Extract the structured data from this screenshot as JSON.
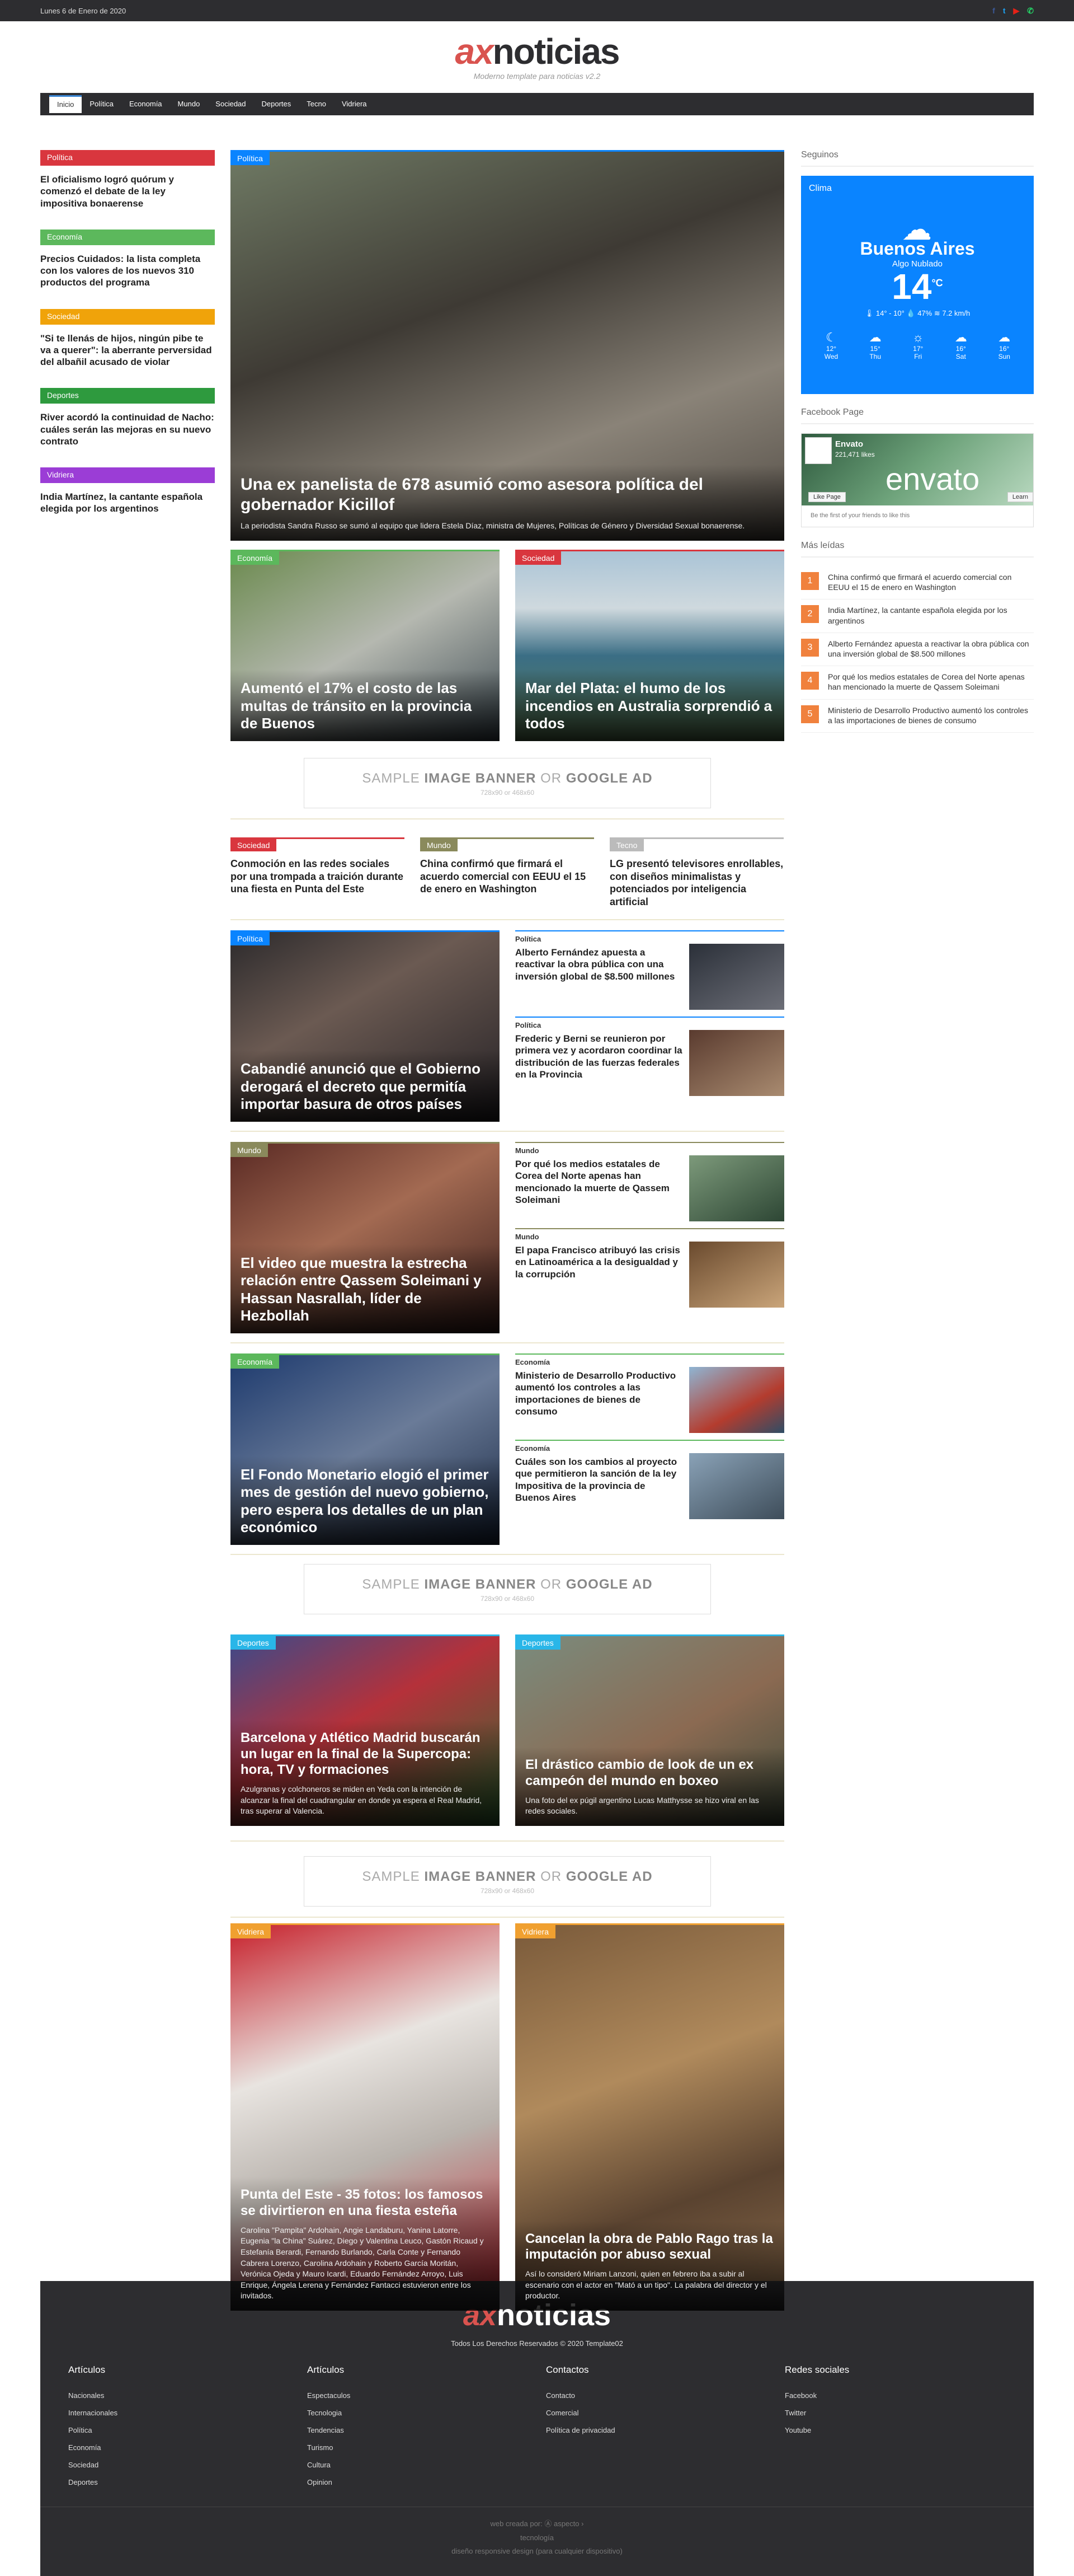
{
  "topbar": {
    "date": "Lunes 6 de Enero de 2020"
  },
  "brand": {
    "ax": "ax",
    "noticias": "noticias",
    "tagline": "Moderno template para noticias v2.2"
  },
  "nav": [
    "Inicio",
    "Política",
    "Economía",
    "Mundo",
    "Sociedad",
    "Deportes",
    "Tecno",
    "Vidriera"
  ],
  "left": [
    {
      "cat": "Política",
      "color": "#d9363e",
      "title": "El oficialismo logró quórum y comenzó el debate de la ley impositiva bonaerense"
    },
    {
      "cat": "Economía",
      "color": "#5cb85c",
      "title": "Precios Cuidados: la lista completa con los valores de los nuevos 310 productos del programa"
    },
    {
      "cat": "Sociedad",
      "color": "#f0a30a",
      "title": "\"Si te llenás de hijos, ningún pibe te va a querer\": la aberrante perversidad del albañil acusado de violar"
    },
    {
      "cat": "Deportes",
      "color": "#2e9a3e",
      "title": "River acordó la continuidad de Nacho: cuáles serán las mejoras en su nuevo contrato"
    },
    {
      "cat": "Vidriera",
      "color": "#9b3dd6",
      "title": "India Martínez, la cantante española elegida por los argentinos"
    }
  ],
  "hero": {
    "cat": "Política",
    "title": "Una ex panelista de 678 asumió como asesora política del gobernador Kicillof",
    "desc": "La periodista Sandra Russo se sumó al equipo que lidera Estela Díaz, ministra de Mujeres, Políticas de Género y Diversidad Sexual bonaerense."
  },
  "pair1": [
    {
      "cat": "Economía",
      "title": "Aumentó el 17% el costo de las multas de tránsito en la provincia de Buenos"
    },
    {
      "cat": "Sociedad",
      "title": "Mar del Plata: el humo de los incendios en Australia sorprendió a todos"
    }
  ],
  "ad": {
    "sample": "SAMPLE",
    "image": "IMAGE BANNER",
    "or": "OR",
    "google": "GOOGLE AD",
    "size": "728x90 or 468x60"
  },
  "row3": [
    {
      "cat": "Sociedad",
      "color": "#d9363e",
      "title": "Conmoción en las redes sociales por una trompada a traición durante una fiesta en Punta del Este"
    },
    {
      "cat": "Mundo",
      "color": "#8a8a5c",
      "title": "China confirmó que firmará el acuerdo comercial con EEUU el 15 de enero en Washington"
    },
    {
      "cat": "Tecno",
      "color": "#bbb",
      "title": "LG presentó televisores enrollables, con diseños minimalistas y potenciados por inteligencia artificial"
    }
  ],
  "blocks": [
    {
      "cat": "Política",
      "catcolor": "#0a84ff",
      "main": "Cabandié anunció que el Gobierno derogará el decreto que permitía importar basura de otros países",
      "items": [
        {
          "k": "Política",
          "h": "Alberto Fernández apuesta a reactivar la obra pública con una inversión global de $8.500 millones"
        },
        {
          "k": "Política",
          "h": "Frederic y Berni se reunieron por primera vez y acordaron coordinar la distribución de las fuerzas federales en la Provincia"
        }
      ]
    },
    {
      "cat": "Mundo",
      "catcolor": "#8a8a5c",
      "main": "El video que muestra la estrecha relación entre Qassem Soleimani y Hassan Nasrallah, líder de Hezbollah",
      "items": [
        {
          "k": "Mundo",
          "h": "Por qué los medios estatales de Corea del Norte apenas han mencionado la muerte de Qassem Soleimani"
        },
        {
          "k": "Mundo",
          "h": "El papa Francisco atribuyó las crisis en Latinoamérica a la desigualdad y la corrupción"
        }
      ]
    },
    {
      "cat": "Economía",
      "catcolor": "#5cb85c",
      "main": "El Fondo Monetario elogió el primer mes de gestión del nuevo gobierno, pero espera los detalles de un plan económico",
      "items": [
        {
          "k": "Economía",
          "h": "Ministerio de Desarrollo Productivo aumentó los controles a las importaciones de bienes de consumo"
        },
        {
          "k": "Economía",
          "h": "Cuáles son los cambios al proyecto que permitieron la sanción de la ley Impositiva de la provincia de Buenos Aires"
        }
      ]
    }
  ],
  "sports": [
    {
      "cat": "Deportes",
      "title": "Barcelona y Atlético Madrid buscarán un lugar en la final de la Supercopa: hora, TV y formaciones",
      "desc": "Azulgranas y colchoneros se miden en Yeda con la intención de alcanzar la final del cuadrangular en donde ya espera el Real Madrid, tras superar al Valencia."
    },
    {
      "cat": "Deportes",
      "title": "El drástico cambio de look de un ex campeón del mundo en boxeo",
      "desc": "Una foto del ex púgil argentino Lucas Matthysse se hizo viral en las redes sociales."
    }
  ],
  "vidriera": [
    {
      "cat": "Vidriera",
      "title": "Punta del Este - 35 fotos: los famosos se divirtieron en una fiesta esteña",
      "desc": "Carolina \"Pampita\" Ardohain, Angie Landaburu, Yanina Latorre, Eugenia \"la China\" Suárez, Diego y Valentina Leuco, Gastón Ricaud y Estefanía Berardi, Fernando Burlando, Carla Conte y Fernando Cabrera Lorenzo, Carolina Ardohain y Roberto García Moritán, Verónica Ojeda y Mauro Icardi, Eduardo Fernández Arroyo, Luis Enrique, Ángela Lerena y Fernández Fantacci estuvieron entre los invitados."
    },
    {
      "cat": "Vidriera",
      "title": "Cancelan la obra de Pablo Rago tras la imputación por abuso sexual",
      "desc": "Así lo consideró Miriam Lanzoni, quien en febrero iba a subir al escenario con el actor en \"Mató a un tipo\". La palabra del director y el productor."
    }
  ],
  "right": {
    "follow": "Seguinos",
    "weather": {
      "label": "Clima",
      "city": "Buenos Aires",
      "desc": "Algo Nublado",
      "temp": "14",
      "unit": "°C",
      "det": "🌡 14° - 10°  💧 47%  ≋ 7.2 km/h",
      "days": [
        {
          "t": "12°",
          "d": "Wed"
        },
        {
          "t": "15°",
          "d": "Thu"
        },
        {
          "t": "17°",
          "d": "Fri"
        },
        {
          "t": "16°",
          "d": "Sat"
        },
        {
          "t": "16°",
          "d": "Sun"
        }
      ]
    },
    "fbhead": "Facebook Page",
    "fb": {
      "name": "Envato",
      "count": "221,471 likes",
      "env": "envato",
      "like": "Like Page",
      "learn": "Learn",
      "friends": "Be the first of your friends to like this"
    },
    "popular": "Más leídas",
    "pop": [
      "China confirmó que firmará el acuerdo comercial con EEUU el 15 de enero en Washington",
      "India Martínez, la cantante española elegida por los argentinos",
      "Alberto Fernández apuesta a reactivar la obra pública con una inversión global de $8.500 millones",
      "Por qué los medios estatales de Corea del Norte apenas han mencionado la muerte de Qassem Soleimani",
      "Ministerio de Desarrollo Productivo aumentó los controles a las importaciones de bienes de consumo"
    ]
  },
  "footer": {
    "copy": "Todos Los Derechos Reservados © 2020 Template02",
    "cols": [
      {
        "h": "Artículos",
        "items": [
          "Nacionales",
          "Internacionales",
          "Política",
          "Economía",
          "Sociedad",
          "Deportes"
        ]
      },
      {
        "h": "Artículos",
        "items": [
          "Espectaculos",
          "Tecnologia",
          "Tendencias",
          "Turismo",
          "Cultura",
          "Opinion"
        ]
      },
      {
        "h": "Contactos",
        "items": [
          "Contacto",
          "Comercial",
          "Política de privacidad"
        ]
      },
      {
        "h": "Redes sociales",
        "items": [
          "Facebook",
          "Twitter",
          "Youtube"
        ]
      }
    ],
    "web": "web creada por: Ⓐ aspecto ›",
    "tec": "tecnología",
    "dis": "diseño responsive design (para cualquier dispositivo)"
  }
}
